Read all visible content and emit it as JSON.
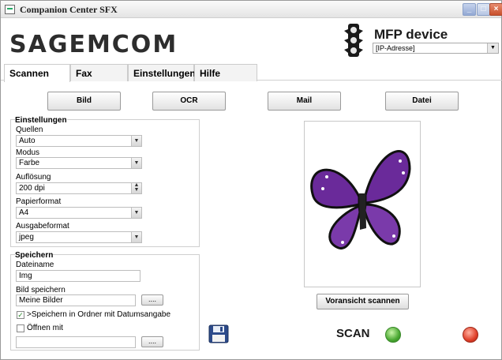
{
  "window": {
    "title": "Companion Center SFX"
  },
  "header": {
    "logo": "SAGEMCOM",
    "device_title": "MFP device",
    "device_select": "[IP-Adresse]"
  },
  "tabs": [
    {
      "label": "Scannen",
      "active": true
    },
    {
      "label": "Fax",
      "active": false
    },
    {
      "label": "Einstellungen",
      "active": false
    },
    {
      "label": "Hilfe",
      "active": false
    }
  ],
  "actions": {
    "bild": "Bild",
    "ocr": "OCR",
    "mail": "Mail",
    "datei": "Datei"
  },
  "settings": {
    "title": "Einstellungen",
    "quellen_label": "Quellen",
    "quellen_value": "Auto",
    "modus_label": "Modus",
    "modus_value": "Farbe",
    "aufloesung_label": "Auflösung",
    "aufloesung_value": "200 dpi",
    "papierformat_label": "Papierformat",
    "papierformat_value": "A4",
    "ausgabeformat_label": "Ausgabeformat",
    "ausgabeformat_value": "jpeg"
  },
  "save": {
    "title": "Speichern",
    "dateiname_label": "Dateiname",
    "dateiname_value": "Img",
    "bild_speichern_label": "Bild speichern",
    "bild_speichern_value": "Meine Bilder",
    "browse_label": "....",
    "datum_checkbox_label": ">Speichern in Ordner mit Datumsangabe",
    "datum_checked": true,
    "oeffnen_label": "Öffnen mit",
    "oeffnen_checked": false,
    "oeffnen_value": ""
  },
  "preview": {
    "button_label": "Voransicht scannen"
  },
  "scan": {
    "label": "SCAN"
  },
  "colors": {
    "butterfly": "#6a2a9a",
    "ok": "#4aa832",
    "cancel": "#e0402a"
  }
}
